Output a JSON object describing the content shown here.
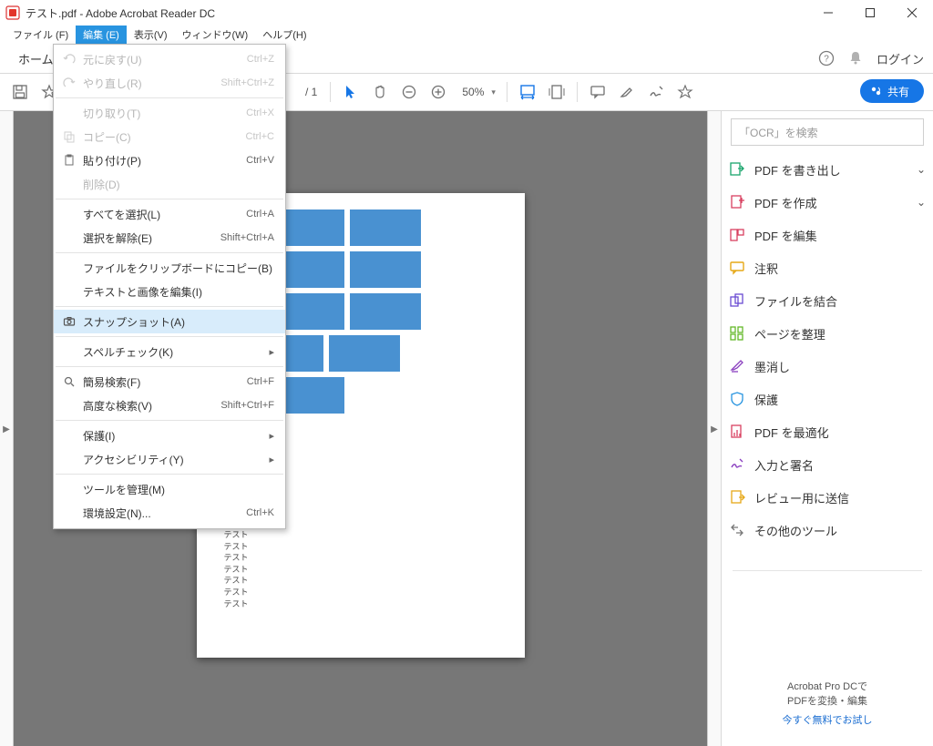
{
  "window": {
    "title": "テスト.pdf - Adobe Acrobat Reader DC"
  },
  "menubar": {
    "file": "ファイル (F)",
    "edit": "編集 (E)",
    "view": "表示(V)",
    "window": "ウィンドウ(W)",
    "help": "ヘルプ(H)"
  },
  "tabs": {
    "home": "ホーム"
  },
  "top_right": {
    "login": "ログイン"
  },
  "toolbar": {
    "page": "/ 1",
    "zoom": "50%"
  },
  "share_button": "共有",
  "edit_menu": {
    "undo": "元に戻す(U)",
    "undo_sk": "Ctrl+Z",
    "redo": "やり直し(R)",
    "redo_sk": "Shift+Ctrl+Z",
    "cut": "切り取り(T)",
    "cut_sk": "Ctrl+X",
    "copy": "コピー(C)",
    "copy_sk": "Ctrl+C",
    "paste": "貼り付け(P)",
    "paste_sk": "Ctrl+V",
    "delete": "削除(D)",
    "select_all": "すべてを選択(L)",
    "select_all_sk": "Ctrl+A",
    "deselect": "選択を解除(E)",
    "deselect_sk": "Shift+Ctrl+A",
    "copy_file": "ファイルをクリップボードにコピー(B)",
    "edit_textimg": "テキストと画像を編集(I)",
    "snapshot": "スナップショット(A)",
    "spellcheck": "スペルチェック(K)",
    "find": "簡易検索(F)",
    "find_sk": "Ctrl+F",
    "adv_search": "高度な検索(V)",
    "adv_search_sk": "Shift+Ctrl+F",
    "protect": "保護(I)",
    "accessibility": "アクセシビリティ(Y)",
    "manage_tools": "ツールを管理(M)",
    "prefs": "環境設定(N)...",
    "prefs_sk": "Ctrl+K"
  },
  "right_panel": {
    "search_placeholder": "「OCR」を検索",
    "export": "PDF を書き出し",
    "create": "PDF を作成",
    "edit": "PDF を編集",
    "comment": "注釈",
    "combine": "ファイルを結合",
    "organize": "ページを整理",
    "redact": "墨消し",
    "protect": "保護",
    "optimize": "PDF を最適化",
    "sign": "入力と署名",
    "review": "レビュー用に送信",
    "more": "その他のツール",
    "footer1": "Acrobat Pro DCで",
    "footer2": "PDFを変換・編集",
    "footer_link": "今すぐ無料でお試し"
  },
  "doc_text_line": "テスト",
  "doc_text_count": 12
}
